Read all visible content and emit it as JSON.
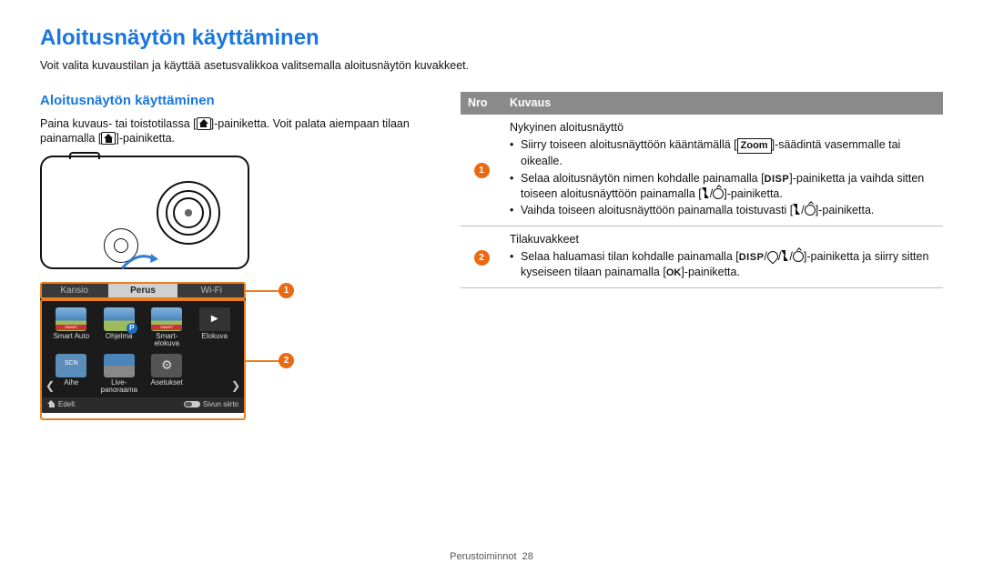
{
  "title": "Aloitusnäytön käyttäminen",
  "subtitle": "Voit valita kuvaustilan ja käyttää asetusvalikkoa valitsemalla aloitusnäytön kuvakkeet.",
  "section_h": "Aloitusnäytön käyttäminen",
  "para": {
    "p1a": "Paina kuvaus- tai toistotilassa [",
    "p1b": "]-painiketta. Voit palata aiempaan tilaan painamalla [",
    "p1c": "]-painiketta."
  },
  "callouts": {
    "c1": "1",
    "c2": "2"
  },
  "screenshot": {
    "tabs": {
      "left": "Kansio",
      "mid": "Perus",
      "right": "Wi-Fi"
    },
    "items": [
      {
        "name": "smart-auto",
        "label": "Smart Auto"
      },
      {
        "name": "ohjelma",
        "label": "Ohjelma"
      },
      {
        "name": "smart-elokuva",
        "label": "Smart-\nelokuva"
      },
      {
        "name": "elokuva",
        "label": "Elokuva"
      },
      {
        "name": "aihe",
        "label": "Aihe"
      },
      {
        "name": "live-panoraama",
        "label": "Live-\npanoraama"
      },
      {
        "name": "asetukset",
        "label": "Asetukset"
      }
    ],
    "arrows": {
      "left": "❮",
      "right": "❯"
    },
    "footer": {
      "back": "Edell.",
      "scroll": "Sivun siirto"
    }
  },
  "table": {
    "head": {
      "nro": "Nro",
      "kuvaus": "Kuvaus"
    },
    "row1": {
      "num": "1",
      "title": "Nykyinen aloitusnäyttö",
      "b1a": "Siirry toiseen aloitusnäyttöön kääntämällä [",
      "b1_zoom": "Zoom",
      "b1b": "]-säädintä vasemmalle tai oikealle.",
      "b2a": "Selaa aloitusnäytön nimen kohdalle painamalla [",
      "b2_disp": "DISP",
      "b2b": "]-painiketta ja vaihda sitten toiseen aloitusnäyttöön painamalla [",
      "b2c": "]-painiketta.",
      "b3a": "Vaihda toiseen aloitusnäyttöön painamalla toistuvasti [",
      "b3b": "]-painiketta."
    },
    "row2": {
      "num": "2",
      "title": "Tilakuvakkeet",
      "b1a": "Selaa haluamasi tilan kohdalle painamalla [",
      "b1_disp": "DISP",
      "b1b": "]-painiketta ja siirry sitten kyseiseen tilaan painamalla [",
      "b1_ok": "OK",
      "b1c": "]-painiketta."
    }
  },
  "footer": {
    "section": "Perustoiminnot",
    "page": "28"
  }
}
